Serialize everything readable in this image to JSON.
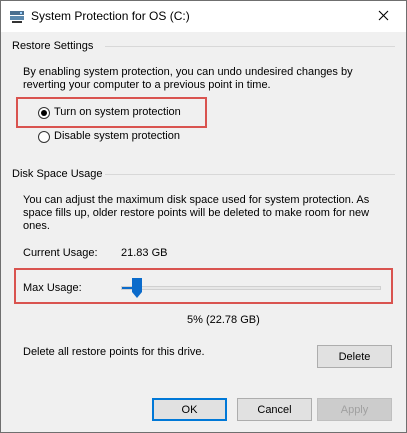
{
  "window": {
    "title": "System Protection for OS (C:)",
    "icons": {
      "app": "system-protection-icon",
      "close": "close-icon"
    }
  },
  "restore_settings": {
    "title": "Restore Settings",
    "description": "By enabling system protection, you can undo undesired changes by reverting your computer to a previous point in time.",
    "options": [
      {
        "label": "Turn on system protection",
        "selected": true
      },
      {
        "label": "Disable system protection",
        "selected": false
      }
    ]
  },
  "disk_space_usage": {
    "title": "Disk Space Usage",
    "description": "You can adjust the maximum disk space used for system protection. As space fills up, older restore points will be deleted to make room for new ones.",
    "current_usage_label": "Current Usage:",
    "current_usage_value": "21.83 GB",
    "max_usage_label": "Max Usage:",
    "max_usage_fraction": 0.05,
    "max_usage_value": "5% (22.78 GB)",
    "delete_text": "Delete all restore points for this drive.",
    "delete_label": "Delete"
  },
  "footer": {
    "ok_label": "OK",
    "cancel_label": "Cancel",
    "apply_label": "Apply"
  },
  "colors": {
    "highlight": "#d9534f",
    "accent": "#0078d7",
    "slider_thumb": "#0b6bcb"
  }
}
